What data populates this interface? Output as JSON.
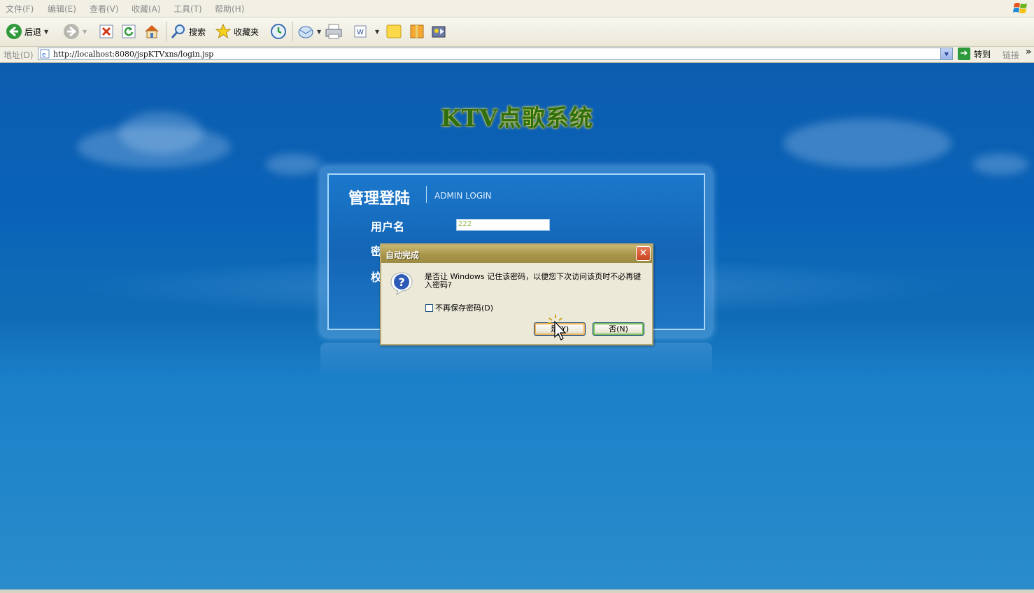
{
  "menu": {
    "items": [
      "文件(F)",
      "编辑(E)",
      "查看(V)",
      "收藏(A)",
      "工具(T)",
      "帮助(H)"
    ]
  },
  "toolbar": {
    "back_label": "后退",
    "search_label": "搜索",
    "favorites_label": "收藏夹"
  },
  "address": {
    "label": "地址(D)",
    "url": "http://localhost:8080/jspKTVxns/login.jsp",
    "goto_label": "转到",
    "links_label": "链接"
  },
  "page": {
    "app_title": "KTV点歌系统",
    "panel_title": "管理登陆",
    "panel_subtitle": "ADMIN LOGIN",
    "username_label": "用户名",
    "password_label_partial": "密",
    "code_label_partial": "校",
    "username_value": "222"
  },
  "dialog": {
    "title": "自动完成",
    "message": "是否让 Windows 记住该密码，以便您下次访问该页时不必再键入密码?",
    "checkbox_label": "不再保存密码(D)",
    "checkbox_checked": false,
    "yes_label": "是(Y)",
    "no_label": "否(N)"
  },
  "colors": {
    "page_bg": "#0a63b8",
    "title_green": "#2f6f0f",
    "dialog_titlebar": "#a8954a",
    "close_red": "#c84420"
  }
}
